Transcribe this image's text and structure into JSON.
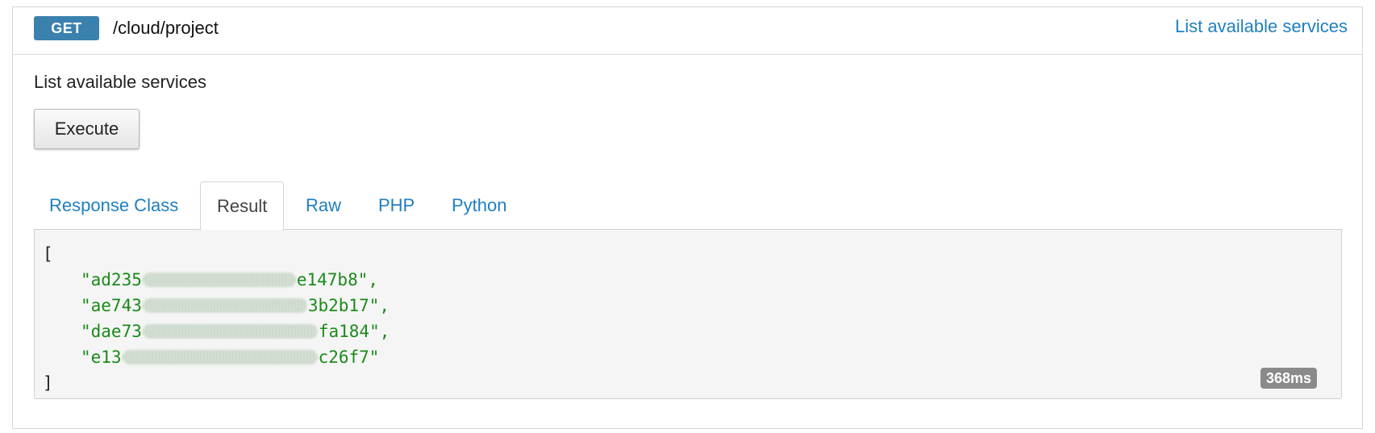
{
  "header": {
    "method": "GET",
    "path": "/cloud/project",
    "summary_link": "List available services"
  },
  "description": "List available services",
  "execute_label": "Execute",
  "tabs": [
    {
      "label": "Response Class",
      "active": false
    },
    {
      "label": "Result",
      "active": true
    },
    {
      "label": "Raw",
      "active": false
    },
    {
      "label": "PHP",
      "active": false
    },
    {
      "label": "Python",
      "active": false
    }
  ],
  "result": {
    "open_bracket": "[",
    "close_bracket": "]",
    "items": [
      {
        "prefix": "\"ad235",
        "suffix": "e147b8\","
      },
      {
        "prefix": "\"ae743",
        "suffix": "3b2b17\","
      },
      {
        "prefix": "\"dae73",
        "suffix": "fa184\","
      },
      {
        "prefix": "\"e13",
        "suffix": "c26f7\""
      }
    ],
    "timing": "368ms"
  },
  "colors": {
    "method_badge": "#3a81ad",
    "link": "#1f7fbf",
    "json_string": "#1b8a1b",
    "timing_badge": "#8a8a8a"
  }
}
